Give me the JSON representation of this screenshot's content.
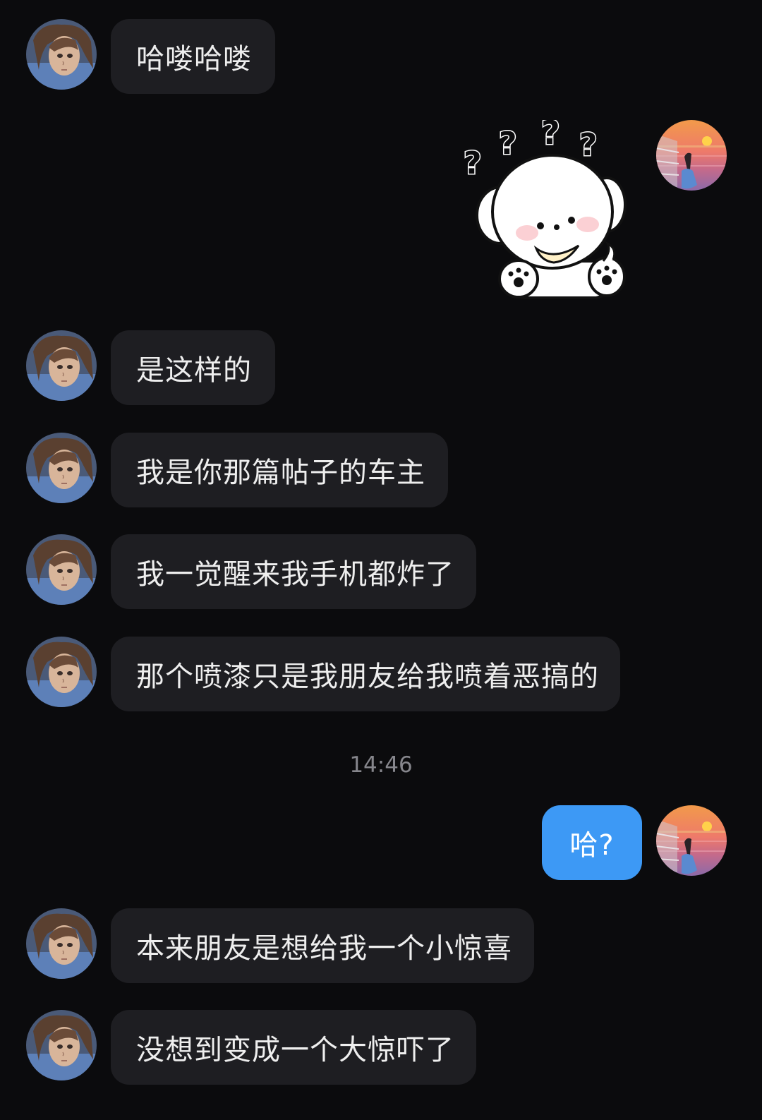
{
  "messages": [
    {
      "side": "in",
      "text": "哈喽哈喽"
    },
    {
      "side": "out",
      "type": "sticker",
      "sticker": "puppy-question-marks",
      "marks": [
        "?",
        "?",
        "?",
        "?"
      ]
    },
    {
      "side": "in",
      "text": "是这样的"
    },
    {
      "side": "in",
      "text": "我是你那篇帖子的车主"
    },
    {
      "side": "in",
      "text": "我一觉醒来我手机都炸了"
    },
    {
      "side": "in",
      "text": "那个喷漆只是我朋友给我喷着恶搞的"
    },
    {
      "side": "out",
      "text": "哈?"
    },
    {
      "side": "in",
      "text": "本来朋友是想给我一个小惊喜"
    },
    {
      "side": "in",
      "text": "没想到变成一个大惊吓了"
    }
  ],
  "timestamp": "14:46",
  "colors": {
    "background": "#0b0b0d",
    "incoming_bubble": "#1e1e22",
    "outgoing_bubble": "#3d99f5",
    "timestamp_text": "#86868c"
  },
  "avatars": {
    "contact": "anime-character-avatar",
    "self": "sunset-sea-avatar"
  }
}
